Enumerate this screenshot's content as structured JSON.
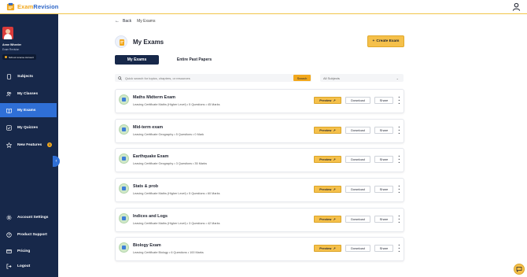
{
  "header": {
    "logo_exam": "Exam",
    "logo_revision": "Revision"
  },
  "user": {
    "name": "Anne Wheeler",
    "subtitle": "Exam Revision",
    "badge": "School License Account"
  },
  "sidebar": {
    "items": [
      {
        "label": "Subjects",
        "icon": "book-icon",
        "active": false
      },
      {
        "label": "My Classes",
        "icon": "people-icon",
        "active": false
      },
      {
        "label": "My Exams",
        "icon": "open-book-icon",
        "active": true
      },
      {
        "label": "My Quizzes",
        "icon": "quiz-icon",
        "active": false
      },
      {
        "label": "New Features",
        "icon": "star-icon",
        "active": false,
        "count": "1"
      },
      {
        "label": "Account Settings",
        "icon": "gear-icon",
        "active": false
      },
      {
        "label": "Product Support",
        "icon": "help-icon",
        "active": false
      },
      {
        "label": "Pricing",
        "icon": "card-icon",
        "active": false
      },
      {
        "label": "Logout",
        "icon": "logout-icon",
        "active": false
      }
    ],
    "collapse": "‹"
  },
  "nav": {
    "back": "Back",
    "breadcrumb": "My Exams"
  },
  "page": {
    "title": "My Exams",
    "create_label": "Create Exam"
  },
  "tabs": [
    "My Exams",
    "Entire Past Papers"
  ],
  "search": {
    "placeholder": "Quick search for topics, chapters, or resources",
    "button": "Search",
    "subject_filter": "All Subjects"
  },
  "actions": {
    "preview": "Preview",
    "download": "Download",
    "share": "Share"
  },
  "exams": [
    {
      "name": "Maths Midterm Exam",
      "meta": "Leaving Certificate Maths (Higher Level) • 5 Questions • 45 Marks"
    },
    {
      "name": "Mid-term exam",
      "meta": "Leaving Certificate Geography • 5 Questions • 0 Mark"
    },
    {
      "name": "Earthquake Exam",
      "meta": "Leaving Certificate Geography • 3 Questions • 35 Marks"
    },
    {
      "name": "Stats & prob",
      "meta": "Leaving Certificate Maths (Higher Level) • 5 Questions • 60 Marks"
    },
    {
      "name": "Indices and Logs",
      "meta": "Leaving Certificate Maths (Higher Level) • 3 Questions • 42 Marks"
    },
    {
      "name": "Biology Exam",
      "meta": "Leaving Certificate Biology • 6 Questions • 100 Marks"
    }
  ],
  "colors": {
    "sidebar": "#17284a",
    "active": "#2f6fd6",
    "accent": "#f5c04a"
  }
}
